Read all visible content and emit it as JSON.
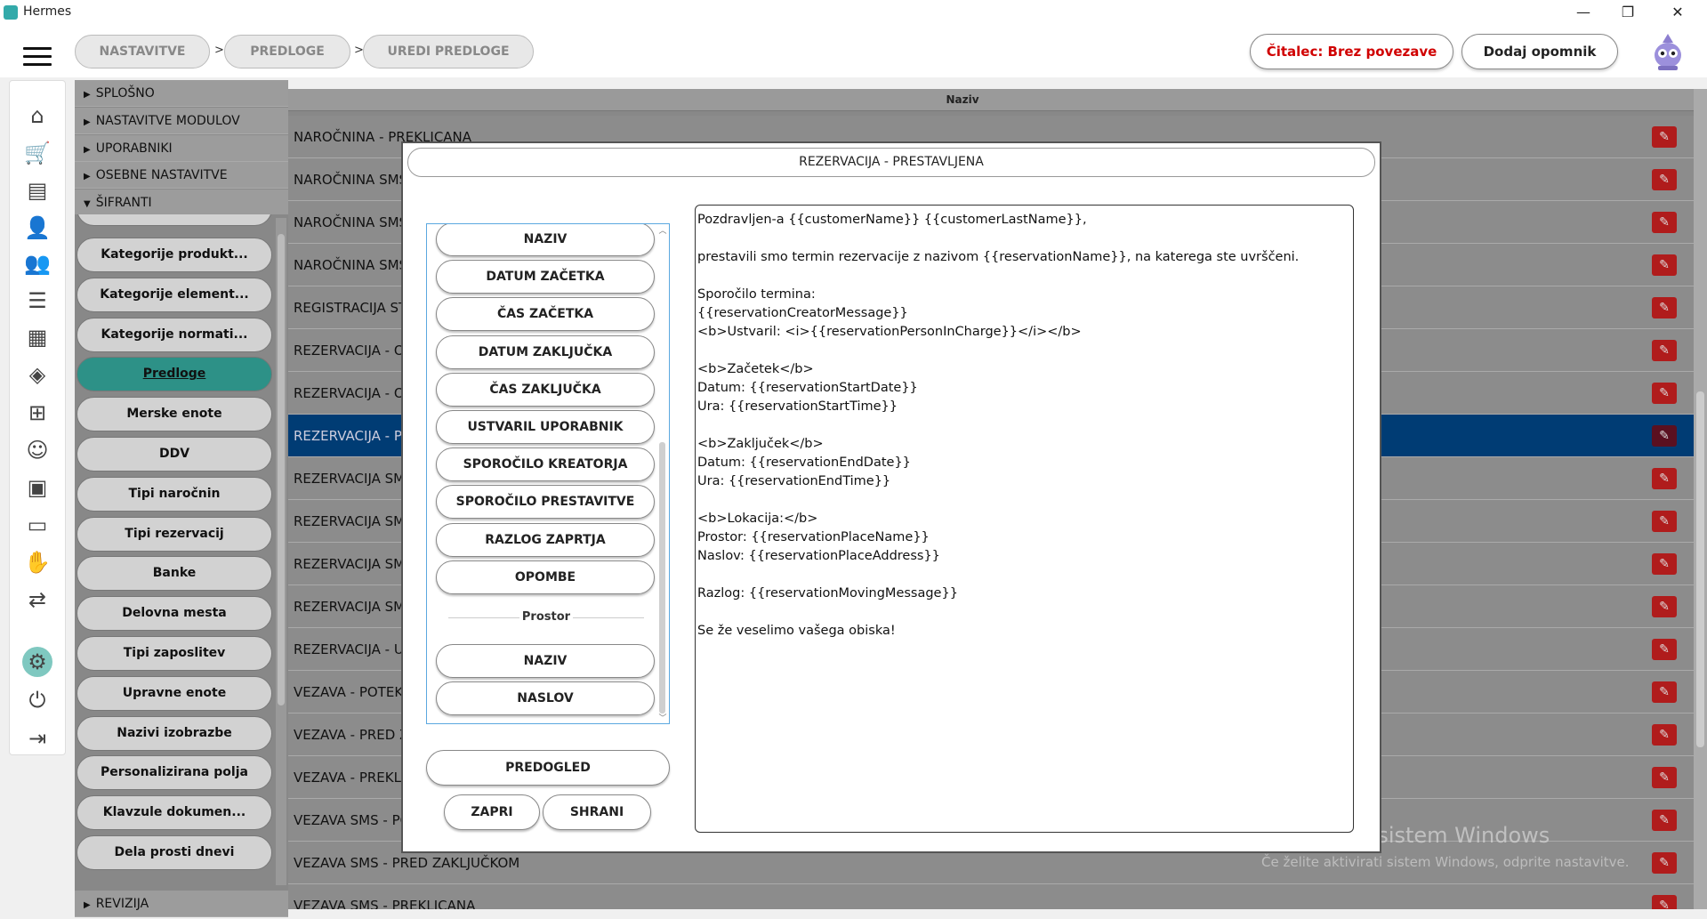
{
  "window": {
    "title": "Hermes",
    "minimize": "—",
    "restore": "❐",
    "close": "✕"
  },
  "breadcrumb": [
    {
      "label": "NASTAVITVE"
    },
    {
      "label": "PREDLOGE"
    },
    {
      "label": "UREDI PREDLOGE"
    }
  ],
  "breadcrumb_sep": ">",
  "header": {
    "reader_status": "Čitalec: Brez povezave",
    "reader_status_color": "#d00000",
    "add_reminder": "Dodaj opomnik"
  },
  "rail_icons": [
    {
      "name": "home-icon",
      "glyph": "⌂"
    },
    {
      "name": "cart-icon",
      "glyph": "🛒"
    },
    {
      "name": "document-icon",
      "glyph": "▤"
    },
    {
      "name": "user-icon",
      "glyph": "👤"
    },
    {
      "name": "users-icon",
      "glyph": "👥"
    },
    {
      "name": "list-icon",
      "glyph": "☰"
    },
    {
      "name": "calendar-icon",
      "glyph": "▦"
    },
    {
      "name": "layers-icon",
      "glyph": "◈"
    },
    {
      "name": "hierarchy-icon",
      "glyph": "⊞"
    },
    {
      "name": "worker-icon",
      "glyph": "☺"
    },
    {
      "name": "briefcase-icon",
      "glyph": "▣"
    },
    {
      "name": "chat-icon",
      "glyph": "▭"
    },
    {
      "name": "handshake-icon",
      "glyph": "✋"
    },
    {
      "name": "transfer-icon",
      "glyph": "⇄"
    },
    {
      "name": "gear-icon",
      "glyph": "⚙"
    },
    {
      "name": "power-icon",
      "glyph": "⏻"
    },
    {
      "name": "logout-icon",
      "glyph": "⇥"
    }
  ],
  "settings_sections": [
    {
      "label": "SPLOŠNO",
      "expanded": false
    },
    {
      "label": "NASTAVITVE MODULOV",
      "expanded": false
    },
    {
      "label": "UPORABNIKI",
      "expanded": false
    },
    {
      "label": "OSEBNE NASTAVITVE",
      "expanded": false
    },
    {
      "label": "ŠIFRANTI",
      "expanded": true
    }
  ],
  "settings_footer": {
    "label": "REVIZIJA"
  },
  "categories": [
    {
      "label": "Kategorije produkt..."
    },
    {
      "label": "Kategorije element..."
    },
    {
      "label": "Kategorije normati..."
    },
    {
      "label": "Predloge",
      "active": true
    },
    {
      "label": "Merske enote"
    },
    {
      "label": "DDV"
    },
    {
      "label": "Tipi naročnin"
    },
    {
      "label": "Tipi rezervacij"
    },
    {
      "label": "Banke"
    },
    {
      "label": "Delovna mesta"
    },
    {
      "label": "Tipi zaposlitev"
    },
    {
      "label": "Upravne enote"
    },
    {
      "label": "Nazivi izobrazbe"
    },
    {
      "label": "Personalizirana polja"
    },
    {
      "label": "Klavzule dokumen..."
    },
    {
      "label": "Dela prosti dnevi"
    }
  ],
  "table": {
    "column_header": "Naziv",
    "rows": [
      {
        "label": "NAROČNINA - PREKLICANA"
      },
      {
        "label": "NAROČNINA SMS"
      },
      {
        "label": "NAROČNINA SMS"
      },
      {
        "label": "NAROČNINA SMS"
      },
      {
        "label": "REGISTRACIJA STR"
      },
      {
        "label": "REZERVACIJA - OD"
      },
      {
        "label": "REZERVACIJA - OP"
      },
      {
        "label": "REZERVACIJA - PR",
        "selected": true
      },
      {
        "label": "REZERVACIJA SMS"
      },
      {
        "label": "REZERVACIJA SMS"
      },
      {
        "label": "REZERVACIJA SMS"
      },
      {
        "label": "REZERVACIJA SMS"
      },
      {
        "label": "REZERVACIJA - US"
      },
      {
        "label": "VEZAVA - POTEKL"
      },
      {
        "label": "VEZAVA - PRED Z"
      },
      {
        "label": "VEZAVA - PREKLIC"
      },
      {
        "label": "VEZAVA SMS - PO"
      },
      {
        "label": "VEZAVA SMS - PRED ZAKLJUČKOM"
      },
      {
        "label": "VEZAVA SMS - PREKLICANA"
      }
    ],
    "edit_glyph": "✎"
  },
  "watermark": {
    "line1": "Aktivirajte sistem Windows",
    "line2": "Če želite aktivirati sistem Windows, odprite nastavitve."
  },
  "modal": {
    "title": "REZERVACIJA - PRESTAVLJENA",
    "variables": [
      {
        "label": "NAZIV"
      },
      {
        "label": "DATUM ZAČETKA"
      },
      {
        "label": "ČAS ZAČETKA"
      },
      {
        "label": "DATUM ZAKLJUČKA"
      },
      {
        "label": "ČAS ZAKLJUČKA"
      },
      {
        "label": "USTVARIL UPORABNIK"
      },
      {
        "label": "SPOROČILO KREATORJA"
      },
      {
        "label": "SPOROČILO PRESTAVITVE"
      },
      {
        "label": "RAZLOG ZAPRTJA"
      },
      {
        "label": "OPOMBE"
      }
    ],
    "group_label": "Prostor",
    "group_variables": [
      {
        "label": "NAZIV"
      },
      {
        "label": "NASLOV"
      }
    ],
    "preview_button": "PREDOGLED",
    "close_button": "ZAPRI",
    "save_button": "SHRANI",
    "template_text": "Pozdravljen-a {{customerName}} {{customerLastName}},\n\nprestavili smo termin rezervacije z nazivom {{reservationName}}, na katerega ste uvrščeni.\n\nSporočilo termina:\n{{reservationCreatorMessage}}\n<b>Ustvaril: <i>{{reservationPersonInCharge}}</i></b>\n\n<b>Začetek</b>\nDatum: {{reservationStartDate}}\nUra: {{reservationStartTime}}\n\n<b>Zaključek</b>\nDatum: {{reservationEndDate}}\nUra: {{reservationEndTime}}\n\n<b>Lokacija:</b>\nProstor: {{reservationPlaceName}}\nNaslov: {{reservationPlaceAddress}}\n\nRazlog: {{reservationMovingMessage}}\n\nSe že veselimo vašega obiska!"
  }
}
